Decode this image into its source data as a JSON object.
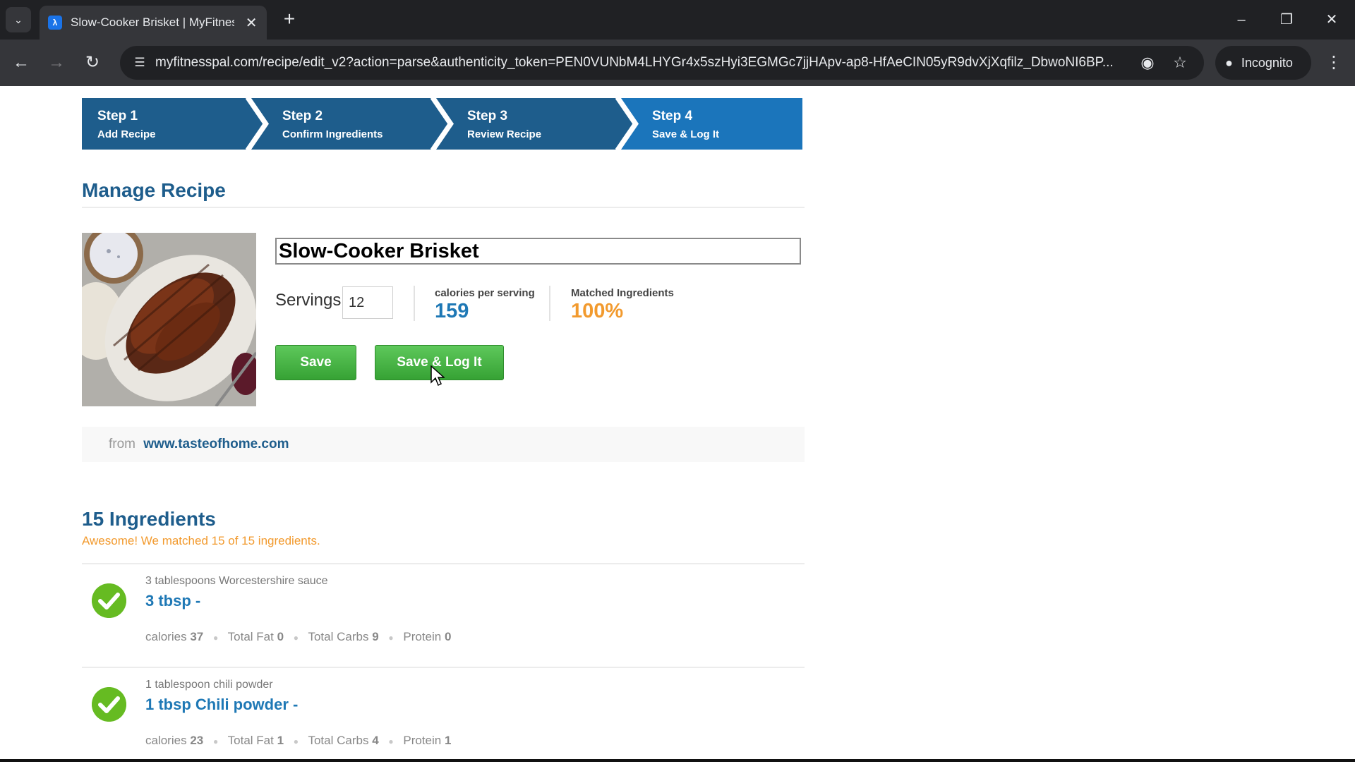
{
  "browser": {
    "tab_title": "Slow-Cooker Brisket | MyFitnessPal",
    "url": "myfitnesspal.com/recipe/edit_v2?action=parse&authenticity_token=PEN0VUNbM4LHYGr4x5szHyi3EGMGc7jjHApv-ap8-HfAeCIN05yR9dvXjXqfilz_DbwoNI6BP...",
    "incognito_label": "Incognito"
  },
  "steps": [
    {
      "title": "Step 1",
      "subtitle": "Add Recipe"
    },
    {
      "title": "Step 2",
      "subtitle": "Confirm Ingredients"
    },
    {
      "title": "Step 3",
      "subtitle": "Review Recipe"
    },
    {
      "title": "Step 4",
      "subtitle": "Save & Log It"
    }
  ],
  "manage": {
    "title": "Manage Recipe",
    "recipe_name": "Slow-Cooker Brisket",
    "servings_label": "Servings",
    "servings_value": "12",
    "calories_label": "calories per serving",
    "calories_value": "159",
    "matched_label": "Matched Ingredients",
    "matched_value": "100%",
    "save_label": "Save",
    "save_log_label": "Save & Log It",
    "source_from": "from",
    "source_link": "www.tasteofhome.com"
  },
  "ingredients": {
    "title": "15 Ingredients",
    "subtitle": "Awesome! We matched 15 of 15 ingredients.",
    "items": [
      {
        "raw": "3 tablespoons Worcestershire sauce",
        "match": "3 tbsp -",
        "calories_label": "calories",
        "calories": "37",
        "fat_label": "Total Fat",
        "fat": "0",
        "carbs_label": "Total Carbs",
        "carbs": "9",
        "protein_label": "Protein",
        "protein": "0"
      },
      {
        "raw": "1 tablespoon chili powder",
        "match": "1 tbsp Chili powder -",
        "calories_label": "calories",
        "calories": "23",
        "fat_label": "Total Fat",
        "fat": "1",
        "carbs_label": "Total Carbs",
        "carbs": "4",
        "protein_label": "Protein",
        "protein": "1"
      }
    ]
  },
  "colors": {
    "step_fill": "#1e5d8c",
    "step_active_fill": "#1b75bb",
    "heading": "#1e5d8c",
    "accent_orange": "#f29a2e",
    "button_green": "#4cb648",
    "check_green": "#66bb22"
  }
}
